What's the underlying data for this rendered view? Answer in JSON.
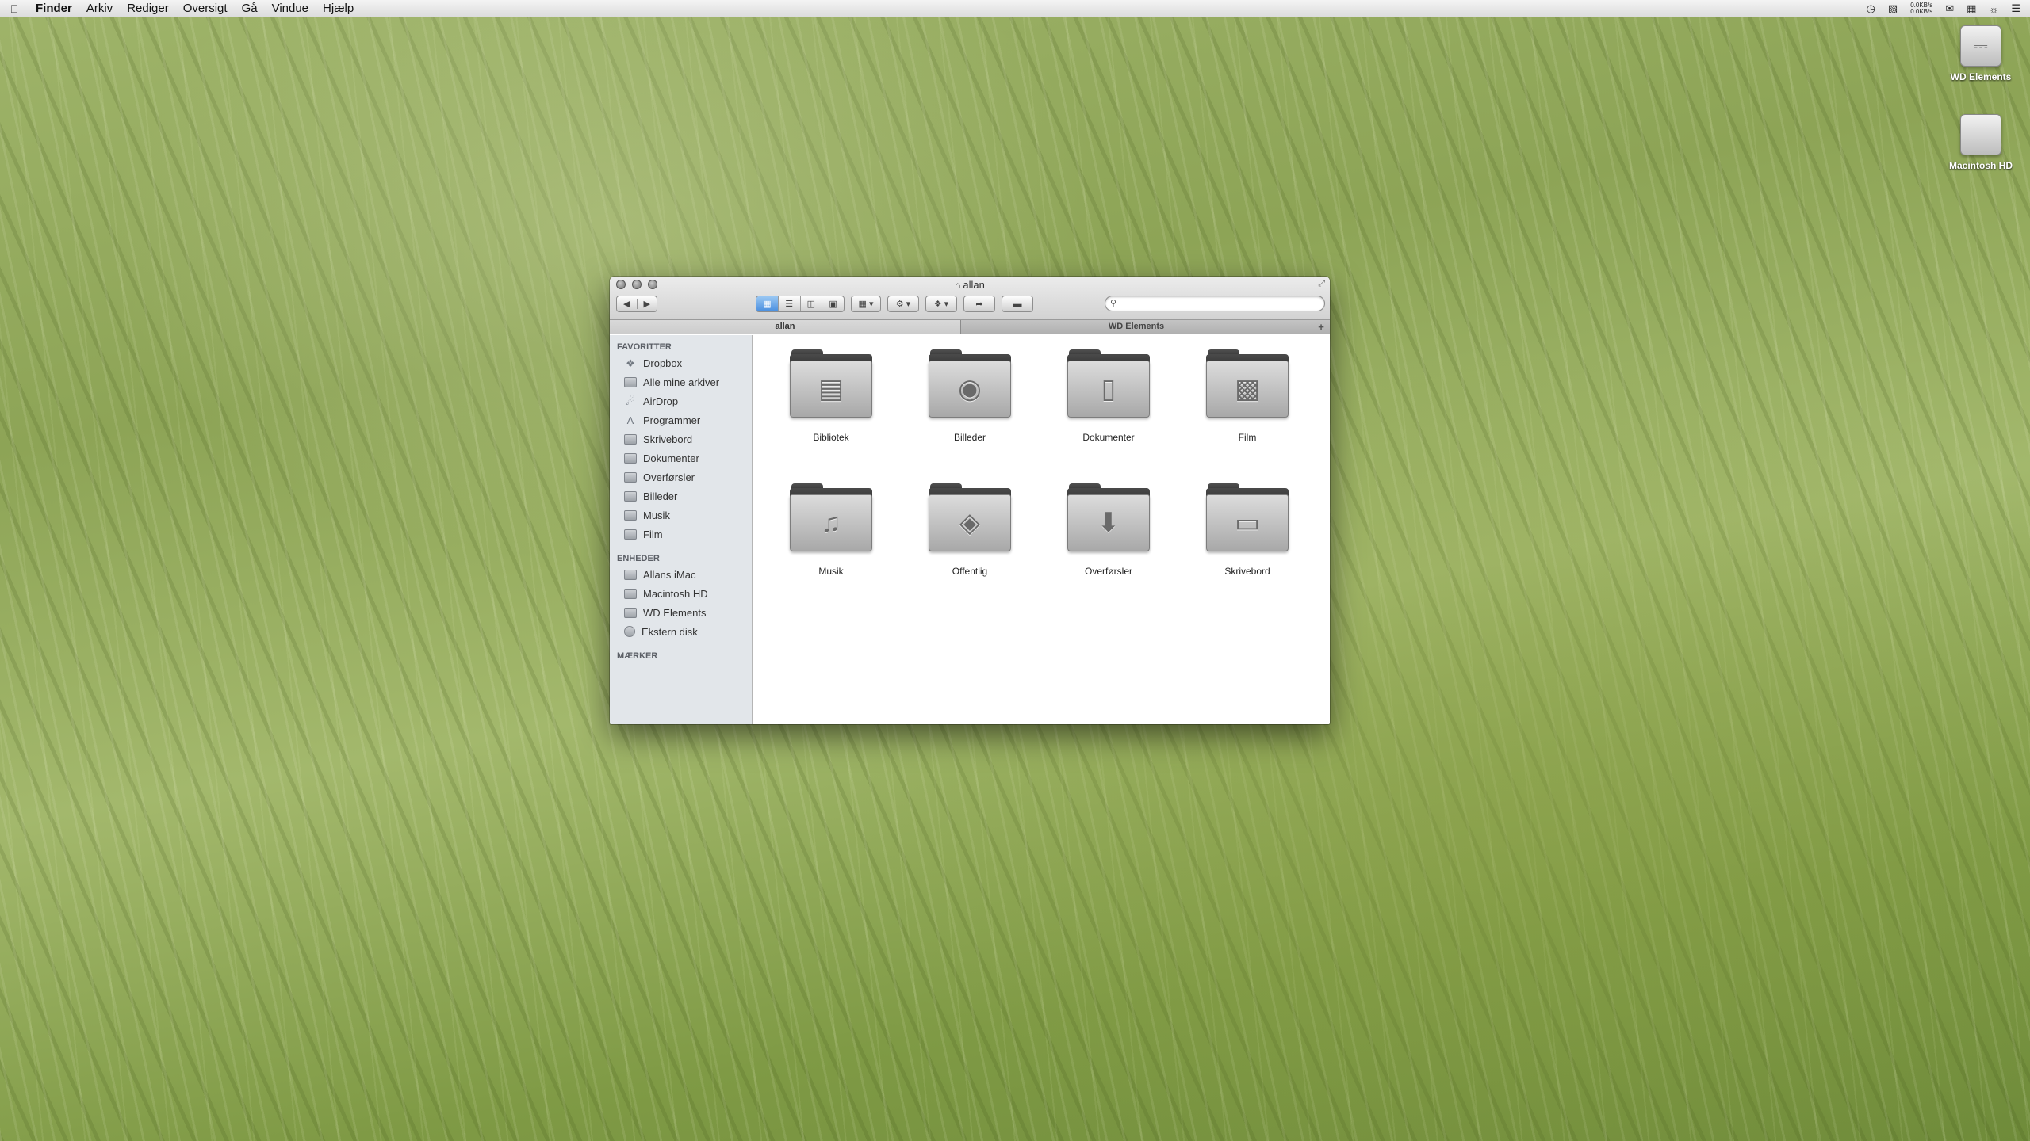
{
  "menubar": {
    "apple_icon": "apple-logo",
    "app": "Finder",
    "items": [
      "Arkiv",
      "Rediger",
      "Oversigt",
      "Gå",
      "Vindue",
      "Hjælp"
    ],
    "net_up": "0.0KB/s",
    "net_down": "0.0KB/s"
  },
  "desktop": {
    "icons": [
      {
        "label": "WD Elements",
        "icon": "usb-drive-icon"
      },
      {
        "label": "Macintosh HD",
        "icon": "hard-drive-icon"
      }
    ]
  },
  "window": {
    "title": "allan",
    "search_placeholder": "",
    "tabs": [
      {
        "label": "allan",
        "active": true
      },
      {
        "label": "WD Elements",
        "active": false
      }
    ],
    "tab_add": "+"
  },
  "sidebar": {
    "favorites_heading": "FAVORITTER",
    "favorites": [
      {
        "label": "Dropbox",
        "icon": "dropbox-icon"
      },
      {
        "label": "Alle mine arkiver",
        "icon": "all-files-icon"
      },
      {
        "label": "AirDrop",
        "icon": "airdrop-icon"
      },
      {
        "label": "Programmer",
        "icon": "applications-icon"
      },
      {
        "label": "Skrivebord",
        "icon": "desktop-icon"
      },
      {
        "label": "Dokumenter",
        "icon": "folder-icon"
      },
      {
        "label": "Overførsler",
        "icon": "folder-icon"
      },
      {
        "label": "Billeder",
        "icon": "folder-icon"
      },
      {
        "label": "Musik",
        "icon": "folder-icon"
      },
      {
        "label": "Film",
        "icon": "folder-icon"
      }
    ],
    "devices_heading": "ENHEDER",
    "devices": [
      {
        "label": "Allans iMac",
        "icon": "computer-icon"
      },
      {
        "label": "Macintosh HD",
        "icon": "hard-drive-icon"
      },
      {
        "label": "WD Elements",
        "icon": "external-drive-icon"
      },
      {
        "label": "Ekstern disk",
        "icon": "disk-icon"
      }
    ],
    "tags_heading": "MÆRKER"
  },
  "content": {
    "folders": [
      {
        "label": "Bibliotek",
        "glyph": "book-icon"
      },
      {
        "label": "Billeder",
        "glyph": "camera-icon"
      },
      {
        "label": "Dokumenter",
        "glyph": "document-icon"
      },
      {
        "label": "Film",
        "glyph": "film-icon"
      },
      {
        "label": "Musik",
        "glyph": "music-note-icon"
      },
      {
        "label": "Offentlig",
        "glyph": "public-sign-icon"
      },
      {
        "label": "Overførsler",
        "glyph": "download-arrow-icon"
      },
      {
        "label": "Skrivebord",
        "glyph": "desktop-screen-icon"
      }
    ]
  }
}
